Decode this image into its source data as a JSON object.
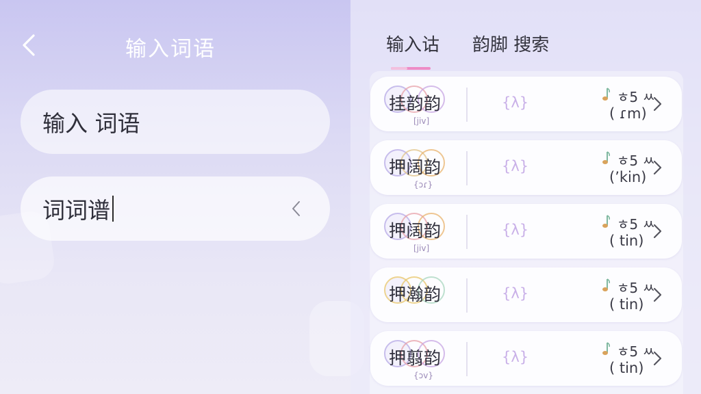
{
  "header": {
    "title": "输入词语"
  },
  "inputs": {
    "primary": {
      "placeholder": "输入 词语"
    },
    "secondary": {
      "value": "词词谱"
    }
  },
  "tabs": [
    {
      "label": "输入诂",
      "active": true
    },
    {
      "label": "韵脚 搜索",
      "active": false
    }
  ],
  "results": [
    {
      "word": "挂韵韵",
      "sub": "[jiv]",
      "badge": "{λ}",
      "label": "ㅎ5 ㅆ",
      "ipa": "( ɾm)",
      "ring_colors": [
        "#b6a8e6",
        "#e7a0a8",
        "#c7a5e3"
      ]
    },
    {
      "word": "押阔韵",
      "sub": "{ɔɾ}",
      "badge": "{λ}",
      "label": "ㅎ5 ㅆ",
      "ipa": "(ʼkin)",
      "ring_colors": [
        "#b6a8e6",
        "#e2c48a",
        "#e8b36e"
      ]
    },
    {
      "word": "押阔韵",
      "sub": "[jiv]",
      "badge": "{λ}",
      "label": "ㅎ5 ㅆ",
      "ipa": "( tin)",
      "ring_colors": [
        "#b6a8e6",
        "#e7a0a8",
        "#e8b36e"
      ]
    },
    {
      "word": "押瀚韵",
      "sub": "",
      "badge": "{λ}",
      "label": "ㅎ5 ㅆ",
      "ipa": "( tin)",
      "ring_colors": [
        "#e8c66a",
        "#e8c66a",
        "#a8d6bf"
      ]
    },
    {
      "word": "押翦韵",
      "sub": "{ɔv}",
      "badge": "{λ}",
      "label": "ㅎ5 ㅆ",
      "ipa": "( tin)",
      "ring_colors": [
        "#b6a8e6",
        "#e7a0a8",
        "#c7a5e3"
      ]
    }
  ]
}
